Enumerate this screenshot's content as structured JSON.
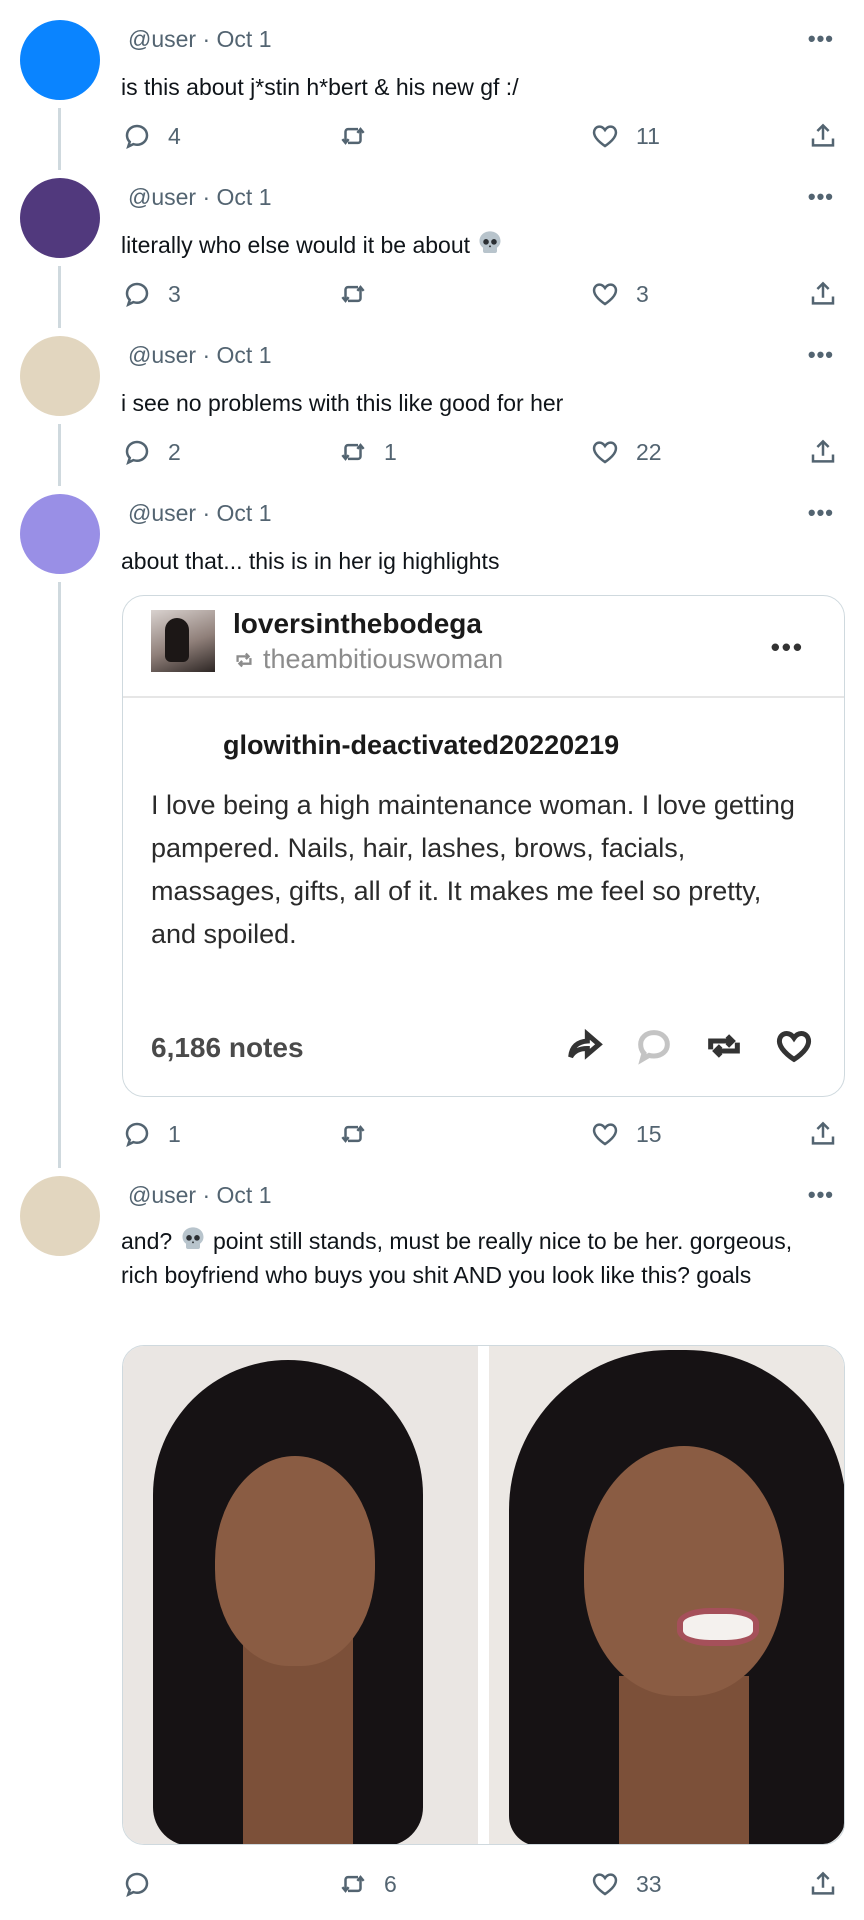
{
  "colors": {
    "avatar1": "#0a84ff",
    "avatar2": "#51397d",
    "avatar3": "#e2d6bf",
    "avatar4": "#998fe6",
    "avatar5": "#e2d6bf",
    "thread_line": "#cfd9de",
    "meta_text": "#536471"
  },
  "tweets": [
    {
      "handle": "@user",
      "sep": "·",
      "date": "Oct 1",
      "text": "is this about j*stin h*bert & his new gf :/",
      "replies": "4",
      "retweets": "",
      "likes": "11"
    },
    {
      "handle": "@user",
      "sep": "·",
      "date": "Oct 1",
      "text": "literally who else would it be about",
      "emoji": "skull",
      "replies": "3",
      "retweets": "",
      "likes": "3"
    },
    {
      "handle": "@user",
      "sep": "·",
      "date": "Oct 1",
      "text": "i see no problems with this like good for her",
      "replies": "2",
      "retweets": "1",
      "likes": "22"
    },
    {
      "handle": "@user",
      "sep": "·",
      "date": "Oct 1",
      "text": "about that... this is in her ig highlights",
      "replies": "1",
      "retweets": "",
      "likes": "15",
      "card": {
        "blog_name": "loversinthebodega",
        "reblogged_from": "theambitiouswoman",
        "original_user": "glowithin-deactivated20220219",
        "body": "I love being a high maintenance woman. I love getting pampered. Nails, hair, lashes, brows, facials, massages, gifts, all of it. It makes me feel so pretty, and spoiled.",
        "notes": "6,186 notes"
      }
    },
    {
      "handle": "@user",
      "sep": "·",
      "date": "Oct 1",
      "text_before": "and?",
      "text_after": "point still stands, must be really nice to be her. gorgeous, rich boyfriend who buys you shit AND you look like this? goals",
      "replies": "",
      "retweets": "6",
      "likes": "33"
    }
  ]
}
